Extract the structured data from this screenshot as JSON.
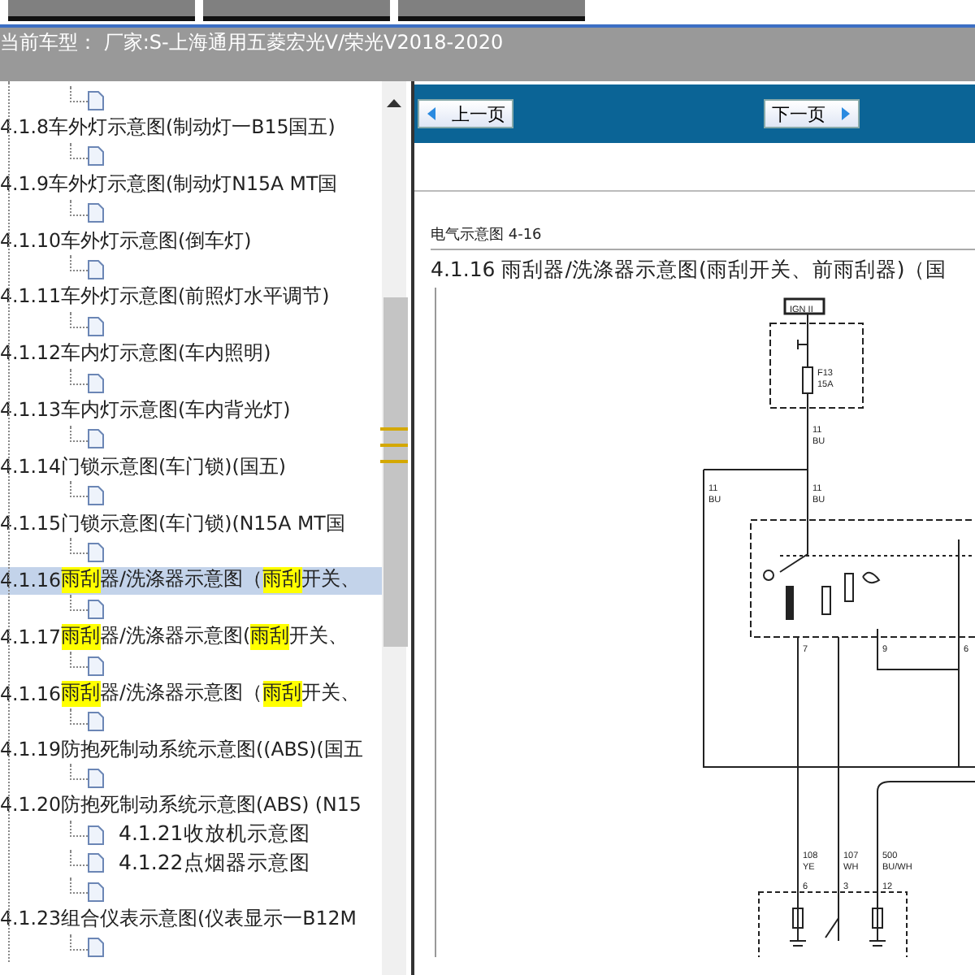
{
  "toolbar": {
    "buttons": [
      {
        "kind": "blank"
      },
      {
        "kind": "blank"
      },
      {
        "kind": "blank"
      }
    ]
  },
  "vehicle_bar": {
    "text": "当前车型：  厂家:S-上海通用五菱宏光V/荣光V2018-2020"
  },
  "tree": [
    {
      "children": [
        {
          "kind": "page"
        }
      ]
    },
    {
      "label": [
        {
          "text": "4.1.8车外灯示意图(制动灯一B15国五)",
          "highlight": false
        }
      ],
      "selected": false,
      "children": [
        {
          "kind": "page"
        }
      ]
    },
    {
      "label": [
        {
          "text": "4.1.9车外灯示意图(制动灯N15A MT国",
          "highlight": false
        }
      ],
      "selected": false,
      "children": [
        {
          "kind": "page"
        }
      ]
    },
    {
      "label": [
        {
          "text": "4.1.10车外灯示意图(倒车灯)",
          "highlight": false
        }
      ],
      "selected": false,
      "children": [
        {
          "kind": "page"
        }
      ]
    },
    {
      "label": [
        {
          "text": "4.1.11车外灯示意图(前照灯水平调节)",
          "highlight": false
        }
      ],
      "selected": false,
      "children": [
        {
          "kind": "page"
        }
      ]
    },
    {
      "label": [
        {
          "text": "4.1.12车内灯示意图(车内照明)",
          "highlight": false
        }
      ],
      "selected": false,
      "children": [
        {
          "kind": "page"
        }
      ]
    },
    {
      "label": [
        {
          "text": "4.1.13车内灯示意图(车内背光灯)",
          "highlight": false
        }
      ],
      "selected": false,
      "children": [
        {
          "kind": "page"
        }
      ]
    },
    {
      "label": [
        {
          "text": "4.1.14门锁示意图(车门锁)(国五)",
          "highlight": false
        }
      ],
      "selected": false,
      "children": [
        {
          "kind": "page"
        }
      ]
    },
    {
      "label": [
        {
          "text": "4.1.15门锁示意图(车门锁)(N15A MT国",
          "highlight": false
        }
      ],
      "selected": false,
      "children": [
        {
          "kind": "page"
        }
      ]
    },
    {
      "label": [
        {
          "text": "4.1.16",
          "highlight": false
        },
        {
          "text": "雨刮",
          "highlight": true
        },
        {
          "text": "器/洗涤器示意图（",
          "highlight": false
        },
        {
          "text": "雨刮",
          "highlight": true
        },
        {
          "text": "开关、",
          "highlight": false
        }
      ],
      "selected": true,
      "children": [
        {
          "kind": "page"
        }
      ]
    },
    {
      "label": [
        {
          "text": "4.1.17",
          "highlight": false
        },
        {
          "text": "雨刮",
          "highlight": true
        },
        {
          "text": "器/洗涤器示意图(",
          "highlight": false
        },
        {
          "text": "雨刮",
          "highlight": true
        },
        {
          "text": "开关、",
          "highlight": false
        }
      ],
      "selected": false,
      "children": [
        {
          "kind": "page"
        }
      ]
    },
    {
      "label": [
        {
          "text": "4.1.16",
          "highlight": false
        },
        {
          "text": "雨刮",
          "highlight": true
        },
        {
          "text": "器/洗涤器示意图（",
          "highlight": false
        },
        {
          "text": "雨刮",
          "highlight": true
        },
        {
          "text": "开关、",
          "highlight": false
        }
      ],
      "selected": false,
      "children": [
        {
          "kind": "page"
        }
      ]
    },
    {
      "label": [
        {
          "text": "4.1.19防抱死制动系统示意图((ABS)(国五",
          "highlight": false
        }
      ],
      "selected": false,
      "children": [
        {
          "kind": "page"
        }
      ]
    },
    {
      "label": [
        {
          "text": "4.1.20防抱死制动系统示意图(ABS) (N15",
          "highlight": false
        }
      ],
      "selected": false,
      "children": [
        {
          "kind": "page",
          "label": "4.1.21收放机示意图"
        },
        {
          "kind": "page",
          "label": "4.1.22点烟器示意图"
        },
        {
          "kind": "page"
        }
      ]
    },
    {
      "label": [
        {
          "text": "4.1.23组合仪表示意图(仪表显示一B12M",
          "highlight": false
        }
      ],
      "selected": false,
      "children": [
        {
          "kind": "page"
        }
      ]
    }
  ],
  "nav": {
    "prev": "上一页",
    "next": "下一页"
  },
  "document": {
    "header": "电气示意图 4-16",
    "title": "4.1.16 雨刮器/洗涤器示意图(雨刮开关、前雨刮器)（国",
    "diagram_labels": [
      "IGN II",
      "F13",
      "15A",
      "11",
      "BU",
      "11",
      "BU",
      "11",
      "BU",
      "7",
      "9",
      "6",
      "108",
      "YE",
      "107",
      "WH",
      "500",
      "BU/WH",
      "6",
      "3",
      "12"
    ]
  }
}
